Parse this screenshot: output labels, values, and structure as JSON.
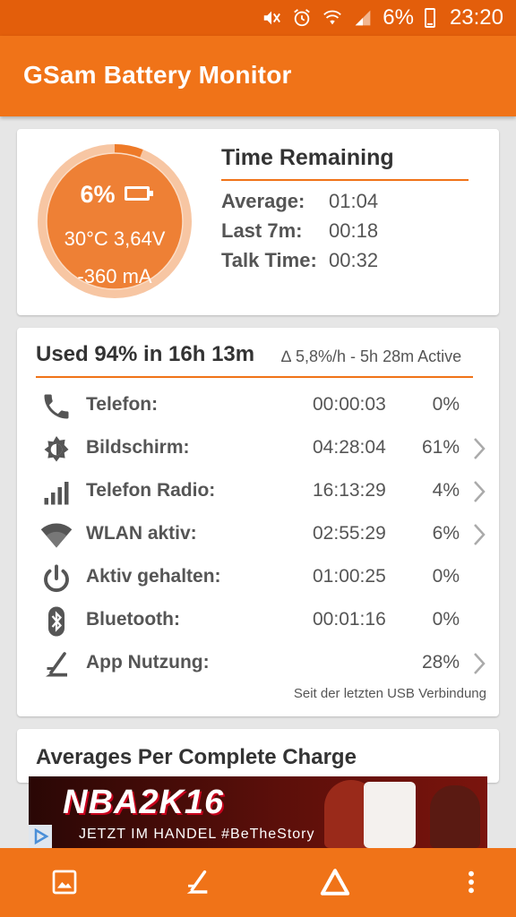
{
  "status_bar": {
    "icons": [
      "mute-icon",
      "alarm-icon",
      "wifi-icon",
      "signal-icon",
      "battery-icon"
    ],
    "battery_percent": "6%",
    "time": "23:20"
  },
  "app_bar": {
    "title": "GSam Battery Monitor"
  },
  "battery_gauge": {
    "percent": "6%",
    "level": 0.06,
    "temp_voltage": "30°C  3,64V",
    "current": "-360 mA"
  },
  "time_remaining": {
    "title": "Time Remaining",
    "rows": [
      {
        "label": "Average:",
        "value": "01:04"
      },
      {
        "label": "Last 7m:",
        "value": "00:18"
      },
      {
        "label": "Talk Time:",
        "value": "00:32"
      }
    ]
  },
  "usage": {
    "headline": "Used 94% in 16h 13m",
    "rate": "∆ 5,8%/h - 5h 28m Active",
    "rows": [
      {
        "icon": "phone-icon",
        "label": "Telefon:",
        "time": "00:00:03",
        "percent": "0%",
        "chevron": false
      },
      {
        "icon": "brightness-icon",
        "label": "Bildschirm:",
        "time": "04:28:04",
        "percent": "61%",
        "chevron": true
      },
      {
        "icon": "cell-signal-icon",
        "label": "Telefon Radio:",
        "time": "16:13:29",
        "percent": "4%",
        "chevron": true
      },
      {
        "icon": "wifi-icon",
        "label": "WLAN aktiv:",
        "time": "02:55:29",
        "percent": "6%",
        "chevron": true
      },
      {
        "icon": "power-icon",
        "label": "Aktiv gehalten:",
        "time": "01:00:25",
        "percent": "0%",
        "chevron": false
      },
      {
        "icon": "bluetooth-icon",
        "label": "Bluetooth:",
        "time": "00:01:16",
        "percent": "0%",
        "chevron": false
      },
      {
        "icon": "app-usage-icon",
        "label": "App Nutzung:",
        "time": "",
        "percent": "28%",
        "chevron": true
      }
    ],
    "footnote": "Seit der letzten USB Verbindung"
  },
  "averages": {
    "title": "Averages Per Complete Charge"
  },
  "ad": {
    "logo": "NBA2K16",
    "tagline": "JETZT IM HANDEL  #BeTheStory"
  },
  "bottom_bar": {
    "buttons": [
      "image-icon",
      "app-usage-icon",
      "delta-icon",
      "overflow-menu-icon"
    ]
  },
  "colors": {
    "primary": "#f07318",
    "status_bar": "#e35e0b",
    "gauge_fill": "#ee8035",
    "gauge_ring": "#f7c6a3",
    "text": "#555555"
  }
}
